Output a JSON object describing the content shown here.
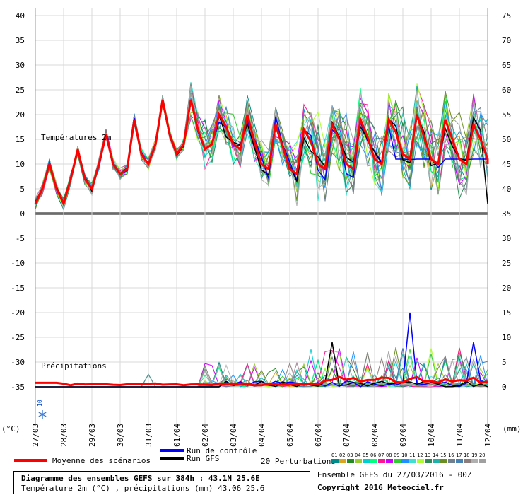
{
  "chart_data": {
    "type": "line",
    "title": "Diagramme des ensembles GEFS sur 384h : 43.1N 25.6E",
    "subtitle": "Température 2m (°C) , précipitations (mm) 43.06 25.6",
    "run_info": "Ensemble GEFS du 27/03/2016 - 00Z",
    "copyright": "Copyright 2016 Meteociel.fr",
    "temp_label": "Températures 2m",
    "precip_label": "Précipitations",
    "left_unit": "(°C)",
    "right_unit": "(mm)",
    "left_ticks": [
      40,
      35,
      30,
      25,
      20,
      15,
      10,
      5,
      0,
      -5,
      -10,
      -15,
      -20,
      -25,
      -30,
      -35
    ],
    "right_ticks": [
      75,
      70,
      65,
      60,
      55,
      50,
      45,
      40,
      35,
      30,
      25,
      20,
      15,
      10,
      5,
      0
    ],
    "ylim_temp": [
      -35,
      40
    ],
    "ylim_precip_mm": [
      0,
      15
    ],
    "hours_total": 384,
    "x_dates": [
      "27/03",
      "28/03",
      "29/03",
      "30/03",
      "31/03",
      "01/04",
      "02/04",
      "03/04",
      "04/04",
      "05/04",
      "06/04",
      "07/04",
      "08/04",
      "09/04",
      "10/04",
      "11/04",
      "12/04"
    ],
    "snow_label": "10%",
    "legend": {
      "mean": "Moyenne des scénarios",
      "control": "Run de contrôle",
      "gfs": "Run GFS",
      "perturb": "20 Perturbations",
      "perturb_ids": [
        "01",
        "02",
        "03",
        "04",
        "05",
        "06",
        "07",
        "08",
        "09",
        "10",
        "11",
        "12",
        "13",
        "14",
        "15",
        "16",
        "17",
        "18",
        "19",
        "20"
      ]
    },
    "colors": {
      "mean": "#ff0000",
      "control": "#0000ff",
      "gfs": "#000000",
      "perturbations": [
        "#008b8b",
        "#daa520",
        "#228b22",
        "#9acd32",
        "#00ced1",
        "#00ff7f",
        "#ff1493",
        "#cc00ff",
        "#32cd32",
        "#1e90ff",
        "#40e0d0",
        "#adff2f",
        "#2e8b57",
        "#20b2aa",
        "#6b8e23",
        "#708090",
        "#4682b4",
        "#8b7d7b",
        "#b0b0b0",
        "#a0a0a0"
      ]
    },
    "temp_anchors": {
      "hours": [
        0,
        6,
        12,
        18,
        24,
        30,
        36,
        42,
        48,
        54,
        60,
        66,
        72,
        78,
        84,
        90,
        96,
        102,
        108,
        114,
        120,
        126,
        132,
        138,
        144,
        150,
        156
      ],
      "mean": [
        2,
        5,
        10,
        5,
        2,
        7,
        13,
        7,
        5,
        10,
        16,
        10,
        8,
        9,
        19,
        12,
        10,
        14,
        23,
        16,
        12,
        14,
        23,
        17,
        13,
        14,
        20
      ]
    },
    "mean_temp_daily": [
      {
        "day": "02/04",
        "max": 20,
        "min": 13
      },
      {
        "day": "03/04",
        "max": 18,
        "min": 9
      },
      {
        "day": "04/04",
        "max": 17,
        "min": 8
      },
      {
        "day": "05/04",
        "max": 18,
        "min": 9
      },
      {
        "day": "06/04",
        "max": 19,
        "min": 9
      },
      {
        "day": "07/04",
        "max": 19,
        "min": 10
      },
      {
        "day": "08/04",
        "max": 20,
        "min": 11
      },
      {
        "day": "09/04",
        "max": 19,
        "min": 10
      },
      {
        "day": "10/04",
        "max": 18,
        "min": 10
      },
      {
        "day": "11/04",
        "max": 18,
        "min": 10
      }
    ],
    "control_temp_max": 11,
    "gfs_temp_end": 2,
    "precip_peaks": [
      {
        "series": "control",
        "hour": 318,
        "mm": 15
      },
      {
        "series": "gfs",
        "hour": 250,
        "mm": 9
      },
      {
        "series": "perturbation",
        "hour": 258,
        "mm": 9
      },
      {
        "series": "perturbation",
        "hour": 210,
        "mm": 8
      },
      {
        "series": "control",
        "hour": 372,
        "mm": 9
      }
    ]
  }
}
